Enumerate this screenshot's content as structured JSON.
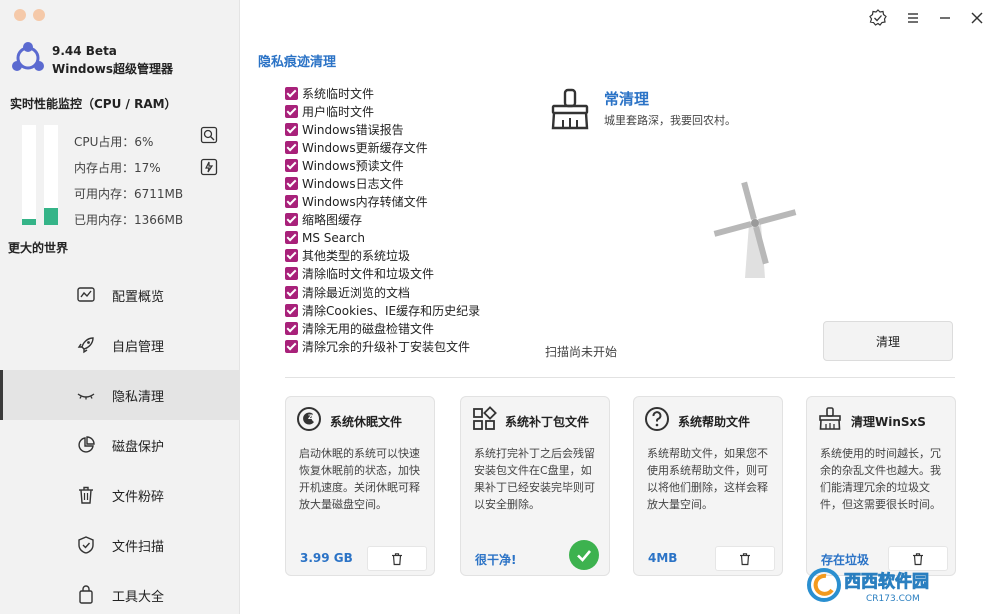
{
  "app": {
    "version": "9.44 Beta",
    "name": "Windows超级管理器"
  },
  "monitor": {
    "title": "实时性能监控（CPU / RAM）",
    "cpu": "CPU占用：6%",
    "mem": "内存占用：17%",
    "available": "可用内存：6711MB",
    "used": "已用内存：1366MB",
    "cpu_level": 0.06,
    "mem_level": 0.17,
    "world": "更大的世界"
  },
  "nav": [
    {
      "label": "配置概览",
      "icon": "chart-icon"
    },
    {
      "label": "自启管理",
      "icon": "rocket-icon"
    },
    {
      "label": "隐私清理",
      "icon": "eye-closed-icon"
    },
    {
      "label": "磁盘保护",
      "icon": "pie-icon"
    },
    {
      "label": "文件粉碎",
      "icon": "trash-icon"
    },
    {
      "label": "文件扫描",
      "icon": "shield-icon"
    },
    {
      "label": "工具大全",
      "icon": "bag-icon"
    }
  ],
  "privacy": {
    "title": "隐私痕迹清理",
    "items": [
      "系统临时文件",
      "用户临时文件",
      "Windows错误报告",
      "Windows更新缓存文件",
      "Windows预读文件",
      "Windows日志文件",
      "Windows内存转储文件",
      "缩略图缓存",
      "MS Search",
      "其他类型的系统垃圾",
      "清除临时文件和垃圾文件",
      "清除最近浏览的文档",
      "清除Cookies、IE缓存和历史纪录",
      "清除无用的磁盘检错文件",
      "清除冗余的升级补丁安装包文件"
    ],
    "clean_title": "常清理",
    "clean_subtitle": "城里套路深，我要回农村。",
    "clean_button": "清理",
    "scan_status": "扫描尚未开始"
  },
  "cards": [
    {
      "title": "系统休眠文件",
      "desc": "启动休眠的系统可以快速恢复休眠前的状态，加快开机速度。关闭休眠可释放大量磁盘空间。",
      "value": "3.99 GB"
    },
    {
      "title": "系统补丁包文件",
      "desc": "系统打完补丁之后会残留安装包文件在C盘里，如果补丁已经安装完毕则可以安全删除。",
      "value": "很干净!"
    },
    {
      "title": "系统帮助文件",
      "desc": "系统帮助文件，如果您不使用系统帮助文件，则可以将他们删除，这样会释放大量空间。",
      "value": "4MB"
    },
    {
      "title": "清理WinSxS",
      "desc": "系统使用的时间越长，冗余的杂乱文件也越大。我们能清理冗余的垃圾文件，但这需要很长时间。",
      "value": "存在垃圾"
    }
  ],
  "watermark": {
    "text": "西西软件园",
    "url": "CR173.COM"
  }
}
